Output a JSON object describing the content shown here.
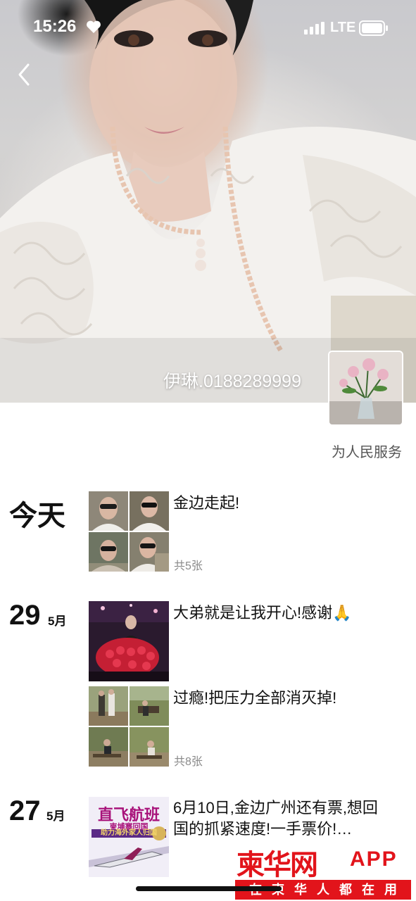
{
  "status_bar": {
    "time": "15:26",
    "network": "LTE",
    "icons": [
      "heart-icon",
      "signal-icon",
      "battery-icon"
    ]
  },
  "header": {
    "back_icon": "chevron-left-icon",
    "owner_name": "伊琳.0188289999",
    "signature": "为人民服务"
  },
  "posts": [
    {
      "date_label": "今天",
      "text": "金边走起!",
      "count": "共5张"
    },
    {
      "day": "29",
      "month": "5月",
      "entries": [
        {
          "text": "大弟就是让我开心!感谢🙏"
        },
        {
          "text": "过瘾!把压力全部消灭掉!",
          "count": "共8张"
        }
      ]
    },
    {
      "day": "27",
      "month": "5月",
      "text": "6月10日,金边广州还有票,想回国的抓紧速度!一手票价!…",
      "image_text": {
        "title": "直飞航班",
        "subtitle": "柬埔寨回国",
        "tagline": "助力海外家人归国"
      }
    }
  ],
  "watermark": {
    "logo": "柬华网",
    "app": "APP",
    "slogan": "在柬华人都在用"
  },
  "colors": {
    "watermark_red": "#e2141b",
    "muted_text": "#8a8a8a",
    "signature_text": "#555555"
  }
}
